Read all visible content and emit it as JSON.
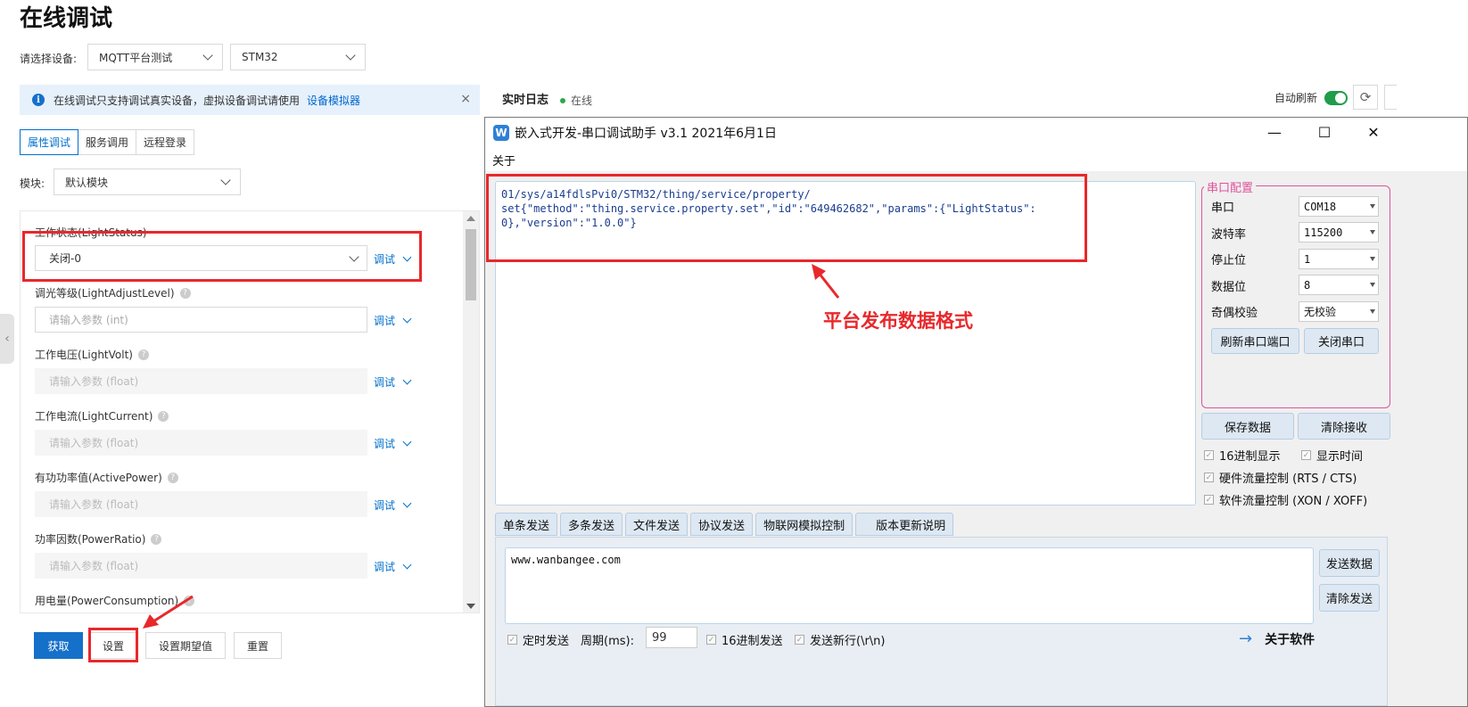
{
  "page": {
    "title": "在线调试",
    "device_label": "请选择设备:",
    "product_select": "MQTT平台测试",
    "device_select": "STM32"
  },
  "info_bar": {
    "text": "在线调试只支持调试真实设备，虚拟设备调试请使用",
    "link": "设备模拟器",
    "close": "×"
  },
  "tabs": [
    "属性调试",
    "服务调用",
    "远程登录"
  ],
  "module": {
    "label": "模块:",
    "value": "默认模块"
  },
  "properties": [
    {
      "label": "工作状态(LightStatus)",
      "value": "关闭-0",
      "placeholder": "",
      "type": "select",
      "help": false
    },
    {
      "label": "调光等级(LightAdjustLevel)",
      "value": "",
      "placeholder": "请输入参数 (int)",
      "type": "input",
      "help": true
    },
    {
      "label": "工作电压(LightVolt)",
      "value": "",
      "placeholder": "请输入参数 (float)",
      "type": "disabled",
      "help": true
    },
    {
      "label": "工作电流(LightCurrent)",
      "value": "",
      "placeholder": "请输入参数 (float)",
      "type": "disabled",
      "help": true
    },
    {
      "label": "有功功率值(ActivePower)",
      "value": "",
      "placeholder": "请输入参数 (float)",
      "type": "disabled",
      "help": true
    },
    {
      "label": "功率因数(PowerRatio)",
      "value": "",
      "placeholder": "请输入参数 (float)",
      "type": "disabled",
      "help": true
    },
    {
      "label": "用电量(PowerConsumption)",
      "value": "",
      "placeholder": "",
      "type": "disabled",
      "help": true
    }
  ],
  "debug_label": "调试",
  "help_glyph": "?",
  "actions": {
    "get": "获取",
    "set": "设置",
    "set_expected": "设置期望值",
    "reset": "重置"
  },
  "log": {
    "title": "实时日志",
    "status": "在线",
    "auto_refresh": "自动刷新"
  },
  "serial_app": {
    "title": "嵌入式开发-串口调试助手 v3.1 2021年6月1日",
    "logo": "W",
    "menu": "关于",
    "received": "01/sys/a14fdlsPvi0/STM32/thing/service/property/\nset{\"method\":\"thing.service.property.set\",\"id\":\"649462682\",\"params\":{\"LightStatus\":\n0},\"version\":\"1.0.0\"}",
    "annotation": "平台发布数据格式",
    "config_title": "串口配置",
    "config": [
      {
        "label": "串口",
        "value": "COM18"
      },
      {
        "label": "波特率",
        "value": "115200"
      },
      {
        "label": "停止位",
        "value": "1"
      },
      {
        "label": "数据位",
        "value": "8"
      },
      {
        "label": "奇偶校验",
        "value": "无校验"
      }
    ],
    "refresh_ports": "刷新串口端口",
    "close_port": "关闭串口",
    "save_data": "保存数据",
    "clear_recv": "清除接收",
    "hex_display": "16进制显示",
    "show_time": "显示时间",
    "rts_cts": "硬件流量控制 (RTS / CTS)",
    "xon_xoff": "软件流量控制 (XON / XOFF)",
    "send_tabs": [
      "单条发送",
      "多条发送",
      "文件发送",
      "协议发送",
      "物联网模拟控制",
      "版本更新说明"
    ],
    "send_text": "www.wanbangee.com",
    "send_data": "发送数据",
    "clear_send": "清除发送",
    "timed_send": "定时发送",
    "period_label": "周期(ms):",
    "period_value": "99",
    "hex_send": "16进制发送",
    "newline": "发送新行(\\r\\n)",
    "about": "关于软件"
  },
  "colors": {
    "accent": "#1570c9",
    "highlight": "#e8282b",
    "online": "#2aa84a",
    "config_border": "#e0539b"
  }
}
